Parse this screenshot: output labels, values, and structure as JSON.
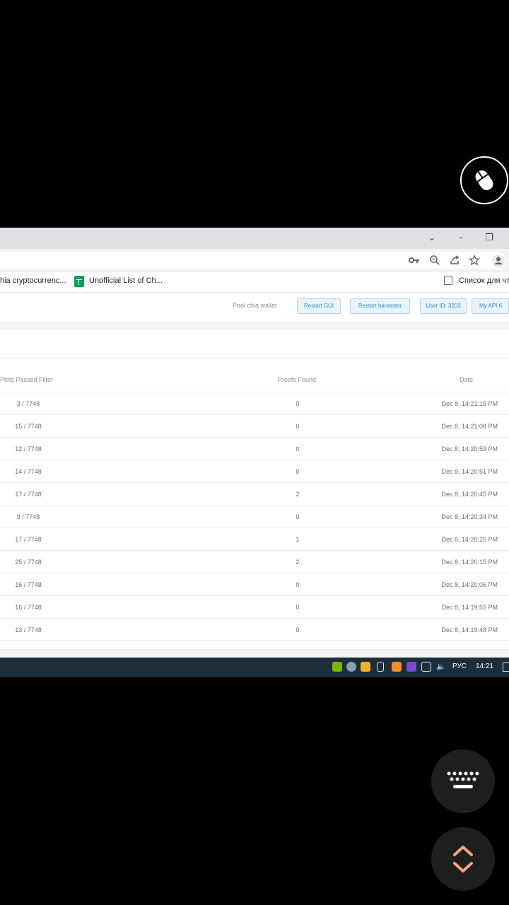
{
  "overlay": {
    "mouse_icon": "mouse-icon",
    "keyboard_icon": "keyboard-icon",
    "scroll_icon": "up-down-chevron-icon"
  },
  "browser": {
    "window_controls": {
      "dropdown": "⌄",
      "minimize": "–",
      "restore": "❐"
    },
    "addr_icons": [
      "key-icon",
      "zoom-icon",
      "share-icon",
      "star-icon",
      "profile-icon"
    ],
    "bookmarks": [
      {
        "label": "hia cryptocurrenc..."
      },
      {
        "label": "Unofficial List of Ch...",
        "icon": "sheets-icon"
      },
      {
        "label": "Список для чт",
        "icon": "reading-list-icon"
      }
    ]
  },
  "app": {
    "pool_link": "Pool chia wallet",
    "buttons": {
      "restart_gui": "Restart GUI",
      "restart_harvester": "Restart harvester",
      "user_id": "User ID: 3203",
      "my_api": "My API K"
    }
  },
  "table": {
    "columns": {
      "plots": "Plots Passed Filter",
      "proofs": "Proofs Found",
      "date": "Date"
    },
    "rows": [
      {
        "plots": "3 / 7748",
        "proofs": "0",
        "date": "Dec 8, 14:21:15 PM"
      },
      {
        "plots": "15 / 7748",
        "proofs": "0",
        "date": "Dec 8, 14:21:08 PM"
      },
      {
        "plots": "12 / 7748",
        "proofs": "0",
        "date": "Dec 8, 14:20:59 PM"
      },
      {
        "plots": "14 / 7748",
        "proofs": "0",
        "date": "Dec 8, 14:20:51 PM"
      },
      {
        "plots": "17 / 7748",
        "proofs": "2",
        "date": "Dec 8, 14:20:45 PM"
      },
      {
        "plots": "9 / 7748",
        "proofs": "0",
        "date": "Dec 8, 14:20:34 PM"
      },
      {
        "plots": "17 / 7748",
        "proofs": "1",
        "date": "Dec 8, 14:20:25 PM"
      },
      {
        "plots": "25 / 7748",
        "proofs": "2",
        "date": "Dec 8, 14:20:15 PM"
      },
      {
        "plots": "16 / 7748",
        "proofs": "0",
        "date": "Dec 8, 14:20:06 PM"
      },
      {
        "plots": "16 / 7748",
        "proofs": "0",
        "date": "Dec 8, 14:19:55 PM"
      },
      {
        "plots": "13 / 7748",
        "proofs": "0",
        "date": "Dec 8, 14:19:48 PM"
      }
    ]
  },
  "taskbar": {
    "language": "РУС",
    "time": "14:21",
    "tray_icons": [
      "nvidia-icon",
      "network-globe-icon",
      "folder-icon",
      "usb-icon",
      "app-orange-icon",
      "app-purple-icon",
      "monitor-icon",
      "volume-muted-icon"
    ]
  }
}
